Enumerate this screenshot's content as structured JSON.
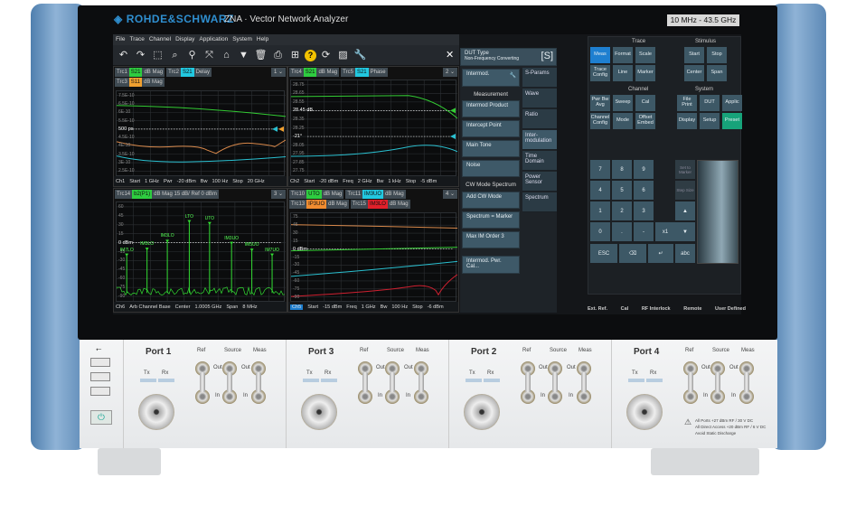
{
  "header": {
    "brand": "ROHDE&SCHWARZ",
    "model": "ZNA · Vector Network Analyzer",
    "freq_range": "10 MHz - 43.5 GHz"
  },
  "menu": [
    "File",
    "Trace",
    "Channel",
    "Display",
    "Application",
    "System",
    "Help"
  ],
  "toolbar": [
    "undo-icon",
    "redo-icon",
    "zoom-select-icon",
    "zoom-icon",
    "zoom-marker-icon",
    "fit-icon",
    "add-trace-icon",
    "add-marker-icon",
    "delete-icon",
    "print-icon",
    "windows-icon",
    "help-icon",
    "refresh-icon",
    "display-icon",
    "wrench-icon"
  ],
  "close_label": "✕",
  "panes": [
    {
      "tags": [
        [
          {
            "trc": "Trc1",
            "param": "S21",
            "color": "#2ecc40",
            "fmt": "dB Mag"
          },
          {
            "trc": "Trc2",
            "param": "S21",
            "color": "#22c8e0",
            "fmt": "Delay"
          }
        ],
        [
          {
            "trc": "Trc3",
            "param": "S11",
            "color": "#f0a030",
            "fmt": "dB Mag"
          }
        ]
      ],
      "selector": "1 ⌄",
      "ylabels": [
        "7.5E-10",
        "6.5E-10",
        "6E-10",
        "5.5E-10",
        "500 ps",
        "4.5E-10",
        "4E-10",
        "3.5E-10",
        "3E-10",
        "2.5E-10"
      ],
      "ref_index": 4,
      "footer": [
        "Ch1",
        "Start",
        "1 GHz",
        "Pwr",
        "-20 dBm",
        "Bw",
        "100 Hz",
        "Stop",
        "20 GHz"
      ]
    },
    {
      "tags": [
        [
          {
            "trc": "Trc4",
            "param": "S21",
            "color": "#2ecc40",
            "fmt": "dB Mag"
          },
          {
            "trc": "Trc5",
            "param": "S21",
            "color": "#22c8e0",
            "fmt": "Phase"
          }
        ]
      ],
      "selector": "2 ⌄",
      "ylabels": [
        "28.75",
        "28.65",
        "28.55",
        "28.45 dB",
        "28.35",
        "28.25",
        "-21°",
        "28.05",
        "27.95",
        "27.85",
        "27.75"
      ],
      "ref_index": 3,
      "ref2_index": 6,
      "footer": [
        "Ch2",
        "Start",
        "-20 dBm",
        "Freq",
        "2 GHz",
        "Bw",
        "1 kHz",
        "Stop",
        "-5 dBm"
      ]
    },
    {
      "tags": [
        [
          {
            "trc": "Trc14",
            "param": "b2(P1)",
            "color": "#2ecc40",
            "fmt": "dB Mag  15 dB/ Ref 0 dBm"
          }
        ]
      ],
      "selector": "3 ⌄",
      "ylabels": [
        "60",
        "45",
        "30",
        "15",
        "0 dBm",
        "-15",
        "-30",
        "-45",
        "-60",
        "-75",
        "-90"
      ],
      "ref_index": 4,
      "markers": [
        "IM7LO",
        "IM5LO",
        "IM3LO",
        "LTO",
        "UTO",
        "IM3UO",
        "IM5UO",
        "IM7UO"
      ],
      "footer": [
        "Ch6",
        "Arb Channel Base",
        "Center",
        "1.0005 GHz",
        "Span",
        "8 MHz"
      ]
    },
    {
      "tags": [
        [
          {
            "trc": "Trc10",
            "param": "UTO",
            "color": "#2ecc40",
            "fmt": "dB Mag"
          },
          {
            "trc": "Trc11",
            "param": "IM3UO",
            "color": "#22c8e0",
            "fmt": "dB Mag"
          }
        ],
        [
          {
            "trc": "Trc13",
            "param": "IP3UO",
            "color": "#f08c30",
            "fmt": "dB Mag"
          },
          {
            "trc": "Trc15",
            "param": "IM3LO",
            "color": "#e0202a",
            "fmt": "dB Mag"
          }
        ]
      ],
      "selector": "4 ⌄",
      "ylabels": [
        "75",
        "45",
        "30",
        "15",
        "0 dBm",
        "-15",
        "-30",
        "-45",
        "-60",
        "-75",
        "-90"
      ],
      "ref_index": 4,
      "footer": [
        "Ch5",
        "Start",
        "-15 dBm",
        "Freq",
        "1 GHz",
        "Bw",
        "100 Hz",
        "Stop",
        "-6 dBm"
      ]
    }
  ],
  "softkeys": {
    "dut_type": "DUT Type",
    "dut_value": "Non-Frequency Converting",
    "dut_icon": "[S]",
    "intermod": "Intermod.",
    "measurement_title": "Measurement",
    "measurement": [
      "Intermod Product",
      "Intercept Point",
      "Main Tone",
      "Noise"
    ],
    "cw_title": "CW Mode Spectrum",
    "cw": [
      "Add CW Mode",
      "Spectrum = Marker",
      "Max IM Order 3"
    ],
    "cal": "Intermod. Pwr. Cal...",
    "tabs": [
      "S-Params",
      "Wave",
      "Ratio",
      "Inter-modulation",
      "Time Domain",
      "Power Sensor",
      "Spectrum"
    ]
  },
  "hardkeys": {
    "sections": [
      "Trace",
      "Stimulus",
      "Channel",
      "System"
    ],
    "trace": [
      "Meas",
      "Format",
      "Scale",
      "Trace Config",
      "Line",
      "Marker"
    ],
    "stimulus": [
      "Start",
      "Stop",
      "Center",
      "Span"
    ],
    "channel": [
      "Pwr Bw Avg",
      "Sweep",
      "Cal",
      "Channel Config",
      "Mode",
      "Offset Embed"
    ],
    "system": [
      "File Print",
      "DUT",
      "Applic",
      "Display",
      "Setup",
      "Preset"
    ],
    "active_color": "#1e7fd0",
    "preset_color": "#17a37a"
  },
  "keypad": {
    "digits": [
      "7",
      "8",
      "9",
      "4",
      "5",
      "6",
      "1",
      "2",
      "3",
      "0",
      ".",
      "-"
    ],
    "x1": "x1",
    "up": "▲",
    "down": "▼",
    "esc": "ESC",
    "backspace": "⌫",
    "enter": "↵",
    "abc": "abc",
    "set_marker": "Set to Marker",
    "step_size": "Step Size"
  },
  "status": [
    "Ext. Ref.",
    "Cal",
    "RF Interlock",
    "Remote",
    "User Defined"
  ],
  "front": {
    "usb": "⭠",
    "ports": [
      {
        "name": "Port 1"
      },
      {
        "name": "Port 3"
      },
      {
        "name": "Port 2"
      },
      {
        "name": "Port 4"
      }
    ],
    "tx": "Tx",
    "rx": "Rx",
    "ref": "Ref",
    "source": "Source",
    "meas": "Meas",
    "out": "Out",
    "in": "In",
    "warning": [
      "All Ports +27 dBm RF / 30 V DC",
      "All Direct Access +20 dBm RF / 6 V DC",
      "Avoid Static Discharge"
    ]
  }
}
